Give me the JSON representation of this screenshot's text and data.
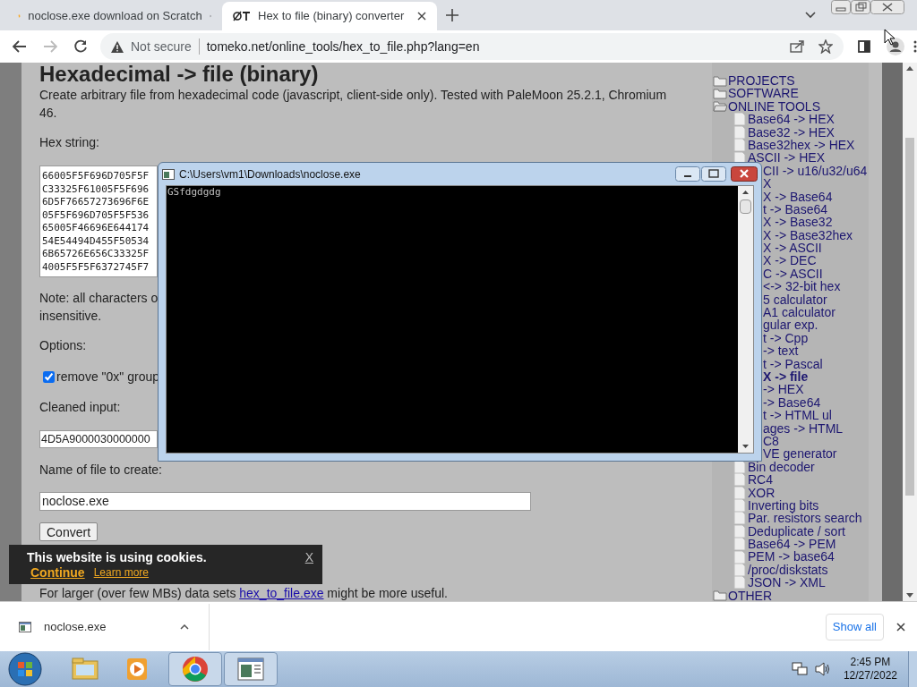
{
  "browser": {
    "tabs": [
      {
        "title": "noclose.exe download on Scratch",
        "selected": false
      },
      {
        "title": "Hex to file (binary) converter",
        "selected": true
      }
    ],
    "address": {
      "security": "Not secure",
      "url": "tomeko.net/online_tools/hex_to_file.php?lang=en"
    }
  },
  "page": {
    "heading": "Hexadecimal -> file (binary)",
    "intro": "Create arbitrary file from hexadecimal code (javascript, client-side only). Tested with PaleMoon 25.2.1, Chromium 46.",
    "hex_label": "Hex string:",
    "hex_lines": [
      "66005F5F696D705F5F",
      "C33325F61005F5F696",
      "6D5F76657273696F6E",
      "05F5F696D705F5F536",
      "65005F46696E644174",
      "54E54494D455F50534",
      "6B65726E656C33325F",
      "4005F5F5F6372745F7"
    ],
    "note": "Note: all characters o",
    "note_2": "insensitive.",
    "options_label": "Options:",
    "options": [
      {
        "label": "remove \"0x\" group",
        "checked": true
      }
    ],
    "cleaned_label": "Cleaned input:",
    "cleaned_value": "4D5A9000030000000",
    "name_label": "Name of file to create:",
    "name_value": "noclose.exe",
    "convert": "Convert",
    "footer": {
      "before": "For larger (over few MBs) data sets ",
      "link": "hex_to_file.exe",
      "after": " might be more useful."
    }
  },
  "sidebar": {
    "items": [
      {
        "label": "PROJECTS",
        "kind": "folder",
        "expanded": false
      },
      {
        "label": "SOFTWARE",
        "kind": "folder",
        "expanded": false
      },
      {
        "label": "ONLINE TOOLS",
        "kind": "folder",
        "expanded": true,
        "children": [
          {
            "label": "Base64 -> HEX",
            "kind": "page",
            "selected": false
          },
          {
            "label": "Base32 -> HEX",
            "kind": "page",
            "selected": false
          },
          {
            "label": "Base32hex -> HEX",
            "kind": "page",
            "selected": false
          },
          {
            "label": "ASCII -> HEX",
            "kind": "page",
            "selected": false
          },
          {
            "label": "CII -> u16/u32/u64",
            "kind": "fragment",
            "selected": false
          },
          {
            "label": "X",
            "kind": "fragment",
            "selected": false
          },
          {
            "label": "X -> Base64",
            "kind": "fragment",
            "selected": false
          },
          {
            "label": "t -> Base64",
            "kind": "fragment",
            "selected": false
          },
          {
            "label": "X -> Base32",
            "kind": "fragment",
            "selected": false
          },
          {
            "label": "X -> Base32hex",
            "kind": "fragment",
            "selected": false
          },
          {
            "label": "X -> ASCII",
            "kind": "fragment",
            "selected": false
          },
          {
            "label": "X -> DEC",
            "kind": "fragment",
            "selected": false
          },
          {
            "label": "C -> ASCII",
            "kind": "fragment",
            "selected": false
          },
          {
            "label": "<-> 32-bit hex",
            "kind": "fragment",
            "selected": false
          },
          {
            "label": "5 calculator",
            "kind": "fragment",
            "selected": false
          },
          {
            "label": "A1 calculator",
            "kind": "fragment",
            "selected": false
          },
          {
            "label": "gular exp.",
            "kind": "fragment",
            "selected": false
          },
          {
            "label": "t -> Cpp",
            "kind": "fragment",
            "selected": false
          },
          {
            "label": "-> text",
            "kind": "fragment",
            "selected": false
          },
          {
            "label": "t -> Pascal",
            "kind": "fragment",
            "selected": false
          },
          {
            "label": "X -> file",
            "kind": "fragment",
            "selected": true
          },
          {
            "label": "-> HEX",
            "kind": "fragment",
            "selected": false
          },
          {
            "label": "-> Base64",
            "kind": "fragment",
            "selected": false
          },
          {
            "label": "t -> HTML ul",
            "kind": "fragment",
            "selected": false
          },
          {
            "label": "ages -> HTML",
            "kind": "fragment",
            "selected": false
          },
          {
            "label": "C8",
            "kind": "fragment",
            "selected": false
          },
          {
            "label": "VE generator",
            "kind": "fragment",
            "selected": false
          },
          {
            "label": "Bin decoder",
            "kind": "page",
            "selected": false
          },
          {
            "label": "RC4",
            "kind": "page",
            "selected": false
          },
          {
            "label": "XOR",
            "kind": "page",
            "selected": false
          },
          {
            "label": "Inverting bits",
            "kind": "page",
            "selected": false
          },
          {
            "label": "Par. resistors search",
            "kind": "page",
            "selected": false
          },
          {
            "label": "Deduplicate / sort",
            "kind": "page",
            "selected": false
          },
          {
            "label": "Base64 -> PEM",
            "kind": "page",
            "selected": false
          },
          {
            "label": "PEM -> base64",
            "kind": "page",
            "selected": false
          },
          {
            "label": "/proc/diskstats",
            "kind": "page",
            "selected": false
          },
          {
            "label": "JSON -> XML",
            "kind": "page",
            "selected": false
          }
        ]
      },
      {
        "label": "OTHER",
        "kind": "folder",
        "expanded": false
      }
    ]
  },
  "console": {
    "title": "C:\\Users\\vm1\\Downloads\\noclose.exe",
    "output": "GSfdgdgdg"
  },
  "cookie_banner": {
    "message": "This website is using cookies.",
    "continue": "Continue",
    "learn_more": "Learn more",
    "close": "X"
  },
  "downloads": {
    "file": "noclose.exe",
    "show_all": "Show all"
  },
  "taskbar": {
    "time": "2:45 PM",
    "date": "12/27/2022"
  }
}
